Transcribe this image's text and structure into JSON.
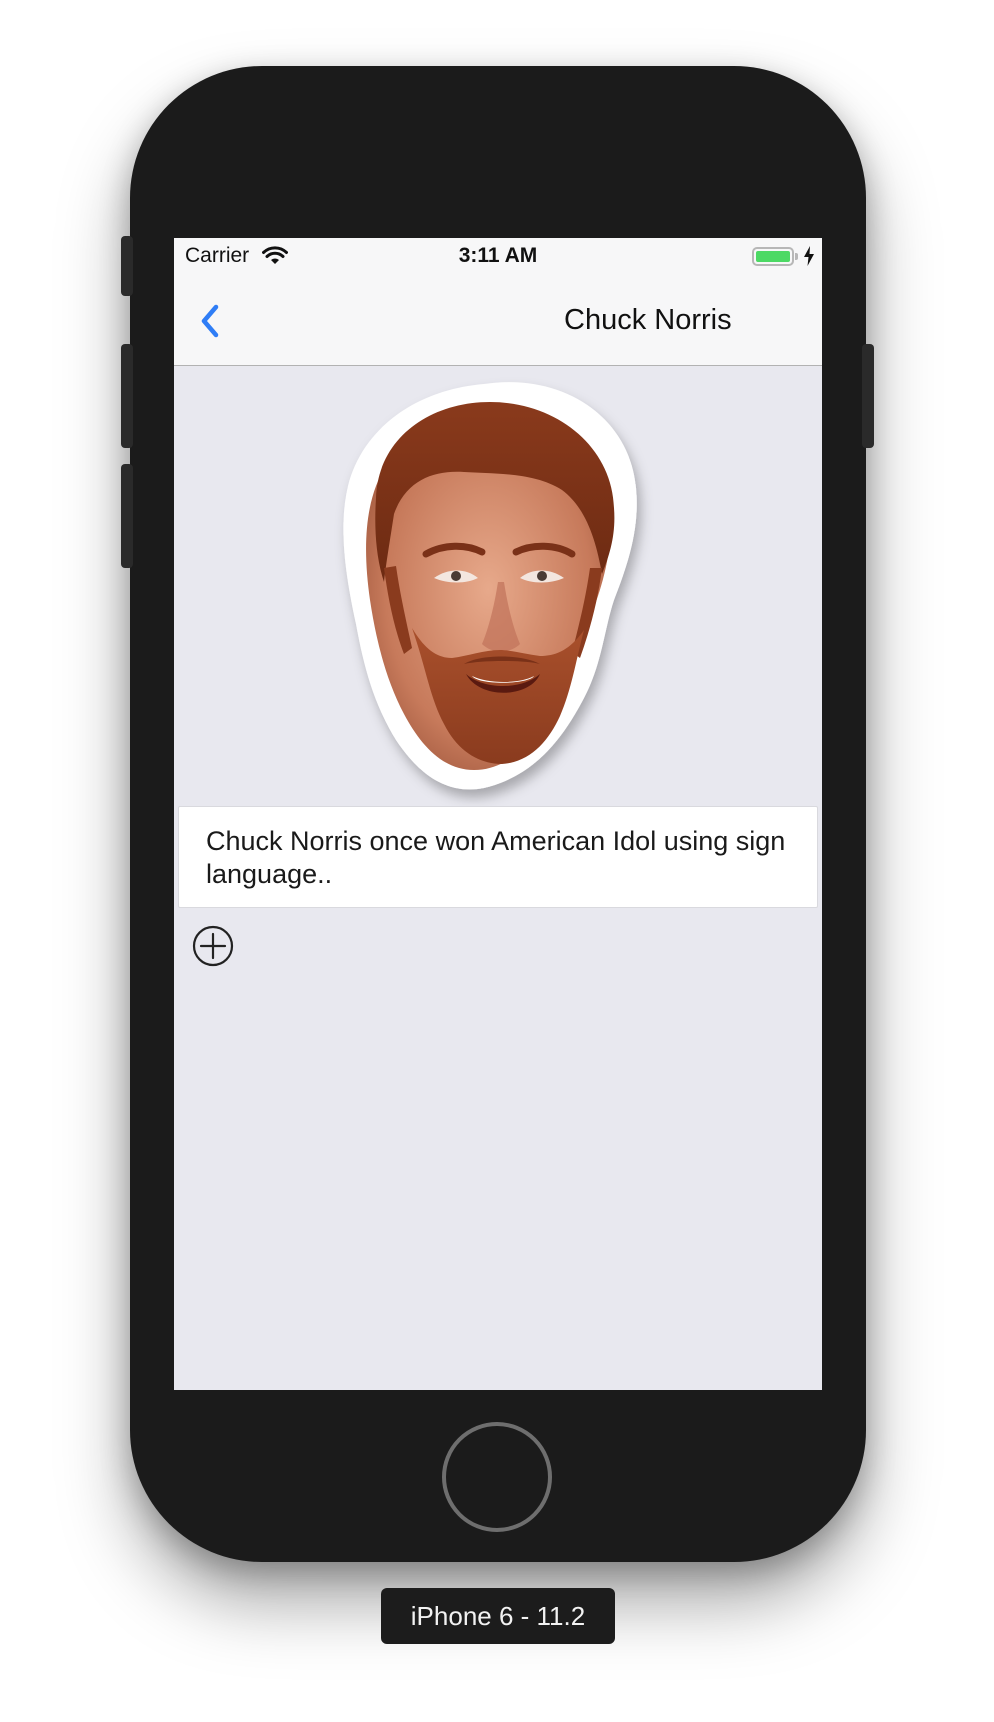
{
  "status_bar": {
    "carrier": "Carrier",
    "time": "3:11 AM",
    "battery_level": 1.0,
    "battery_color": "#4cd964",
    "wifi_icon": "wifi-icon",
    "charging_icon": "charging-bolt-icon"
  },
  "nav": {
    "title": "Chuck Norris",
    "back_icon": "chevron-left-icon",
    "accent_color": "#2f7df6"
  },
  "content": {
    "joke": "Chuck Norris once won American Idol using sign language..",
    "add_icon": "plus-circle-icon"
  },
  "device": {
    "label": "iPhone 6 - 11.2"
  }
}
